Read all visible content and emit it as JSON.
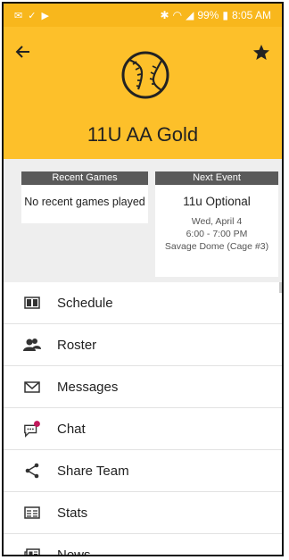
{
  "status_bar": {
    "bluetooth_icon": "bluetooth-icon",
    "signal_icon": "signal-icon",
    "battery": "99%",
    "time": "8:05 AM"
  },
  "header": {
    "team_name": "11U AA Gold",
    "logo_icon": "baseball-icon",
    "background": "#fdc02a"
  },
  "recent_games": {
    "title": "Recent Games",
    "empty_text": "No recent games played"
  },
  "next_event": {
    "title": "Next Event",
    "name": "11u Optional",
    "date": "Wed, April 4",
    "time": "6:00 - 7:00 PM",
    "location": "Savage Dome (Cage #3)"
  },
  "menu": {
    "items": [
      {
        "label": "Schedule",
        "icon": "calendar-icon"
      },
      {
        "label": "Roster",
        "icon": "people-icon"
      },
      {
        "label": "Messages",
        "icon": "envelope-icon"
      },
      {
        "label": "Chat",
        "icon": "chat-bubble-icon"
      },
      {
        "label": "Share Team",
        "icon": "share-icon"
      },
      {
        "label": "Stats",
        "icon": "stats-icon"
      },
      {
        "label": "News",
        "icon": "news-icon"
      }
    ]
  },
  "colors": {
    "accent": "#fdc02a",
    "card_header": "#5a5a5a",
    "chat_badge": "#c2185b"
  }
}
